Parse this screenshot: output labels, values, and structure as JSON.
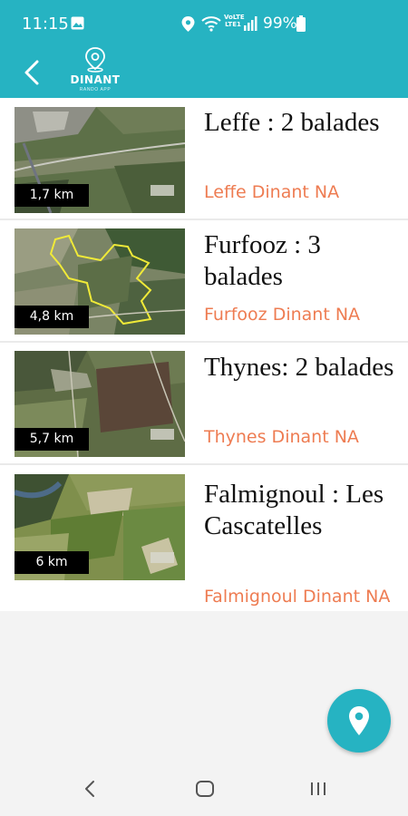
{
  "status_bar": {
    "time": "11:15",
    "network_label": "VoLTE LTE1",
    "battery": "99%"
  },
  "app_bar": {
    "logo_title": "DINANT",
    "logo_subtitle": "RANDO APP"
  },
  "walks": [
    {
      "title": "Leffe : 2 balades",
      "subtitle": "Leffe Dinant NA",
      "distance": "1,7 km"
    },
    {
      "title": "Furfooz : 3 balades",
      "subtitle": "Furfooz Dinant NA",
      "distance": "4,8 km"
    },
    {
      "title": "Thynes: 2 balades",
      "subtitle": "Thynes Dinant NA",
      "distance": "5,7 km"
    },
    {
      "title": "Falmignoul : Les Cascatelles",
      "subtitle": "Falmignoul Dinant NA",
      "distance": "6 km"
    }
  ],
  "colors": {
    "primary": "#26b3c2",
    "accent": "#ee7c52",
    "background": "#f3f3f3"
  },
  "icons": {
    "back": "arrow-left-icon",
    "fab": "map-pin-icon"
  }
}
